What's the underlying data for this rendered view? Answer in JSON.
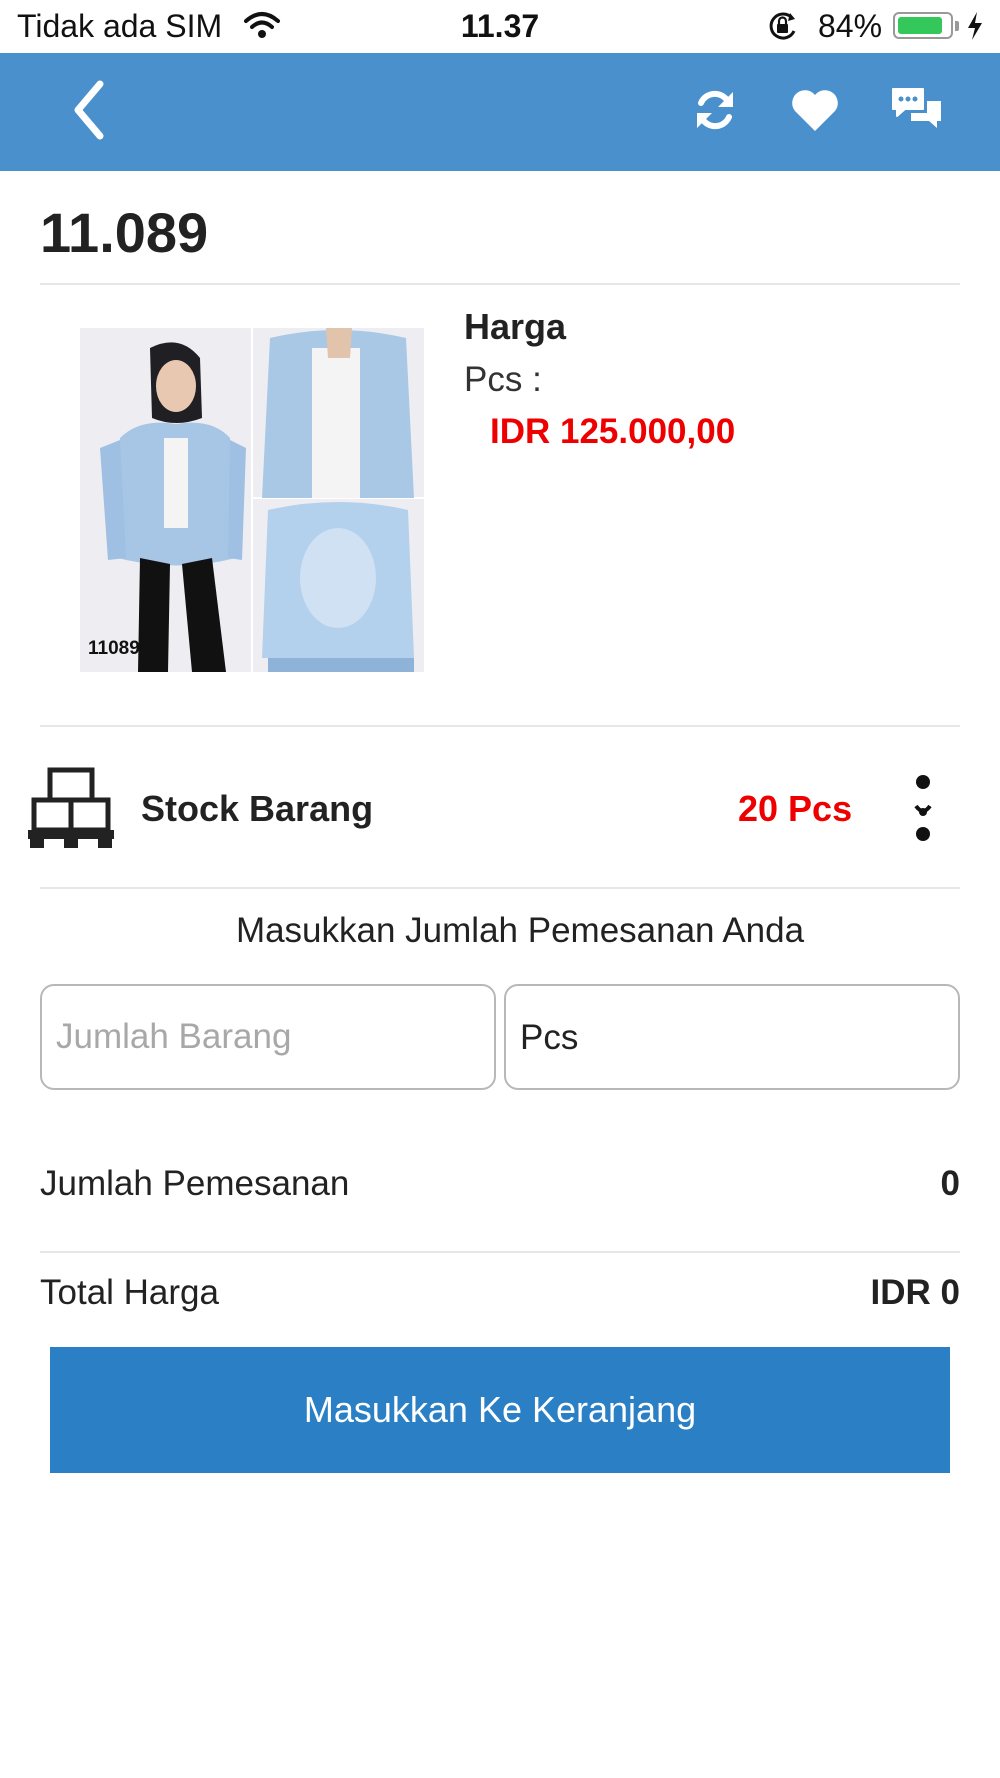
{
  "status_bar": {
    "carrier": "Tidak ada SIM",
    "time": "11.37",
    "battery_percent": "84%",
    "battery_level": 0.84,
    "battery_color": "#34c759"
  },
  "nav": {
    "background": "#4a90cc",
    "icons": [
      "back-chevron-icon",
      "refresh-icon",
      "heart-icon",
      "chat-icon"
    ]
  },
  "product": {
    "code": "11.089",
    "image_label": "11089"
  },
  "price": {
    "title": "Harga",
    "unit_label": "Pcs :",
    "value": "IDR 125.000,00",
    "value_color": "#ee0000"
  },
  "stock": {
    "label": "Stock Barang",
    "value": "20 Pcs",
    "icon": "pallet-boxes-icon"
  },
  "order": {
    "prompt": "Masukkan Jumlah Pemesanan Anda",
    "quantity_placeholder": "Jumlah Barang",
    "quantity_value": "",
    "unit": "Pcs"
  },
  "summary": {
    "quantity_label": "Jumlah Pemesanan",
    "quantity_value": "0",
    "total_label": "Total Harga",
    "total_value": "IDR 0"
  },
  "cart_button": {
    "label": "Masukkan Ke Keranjang",
    "color": "#2b80c5"
  }
}
